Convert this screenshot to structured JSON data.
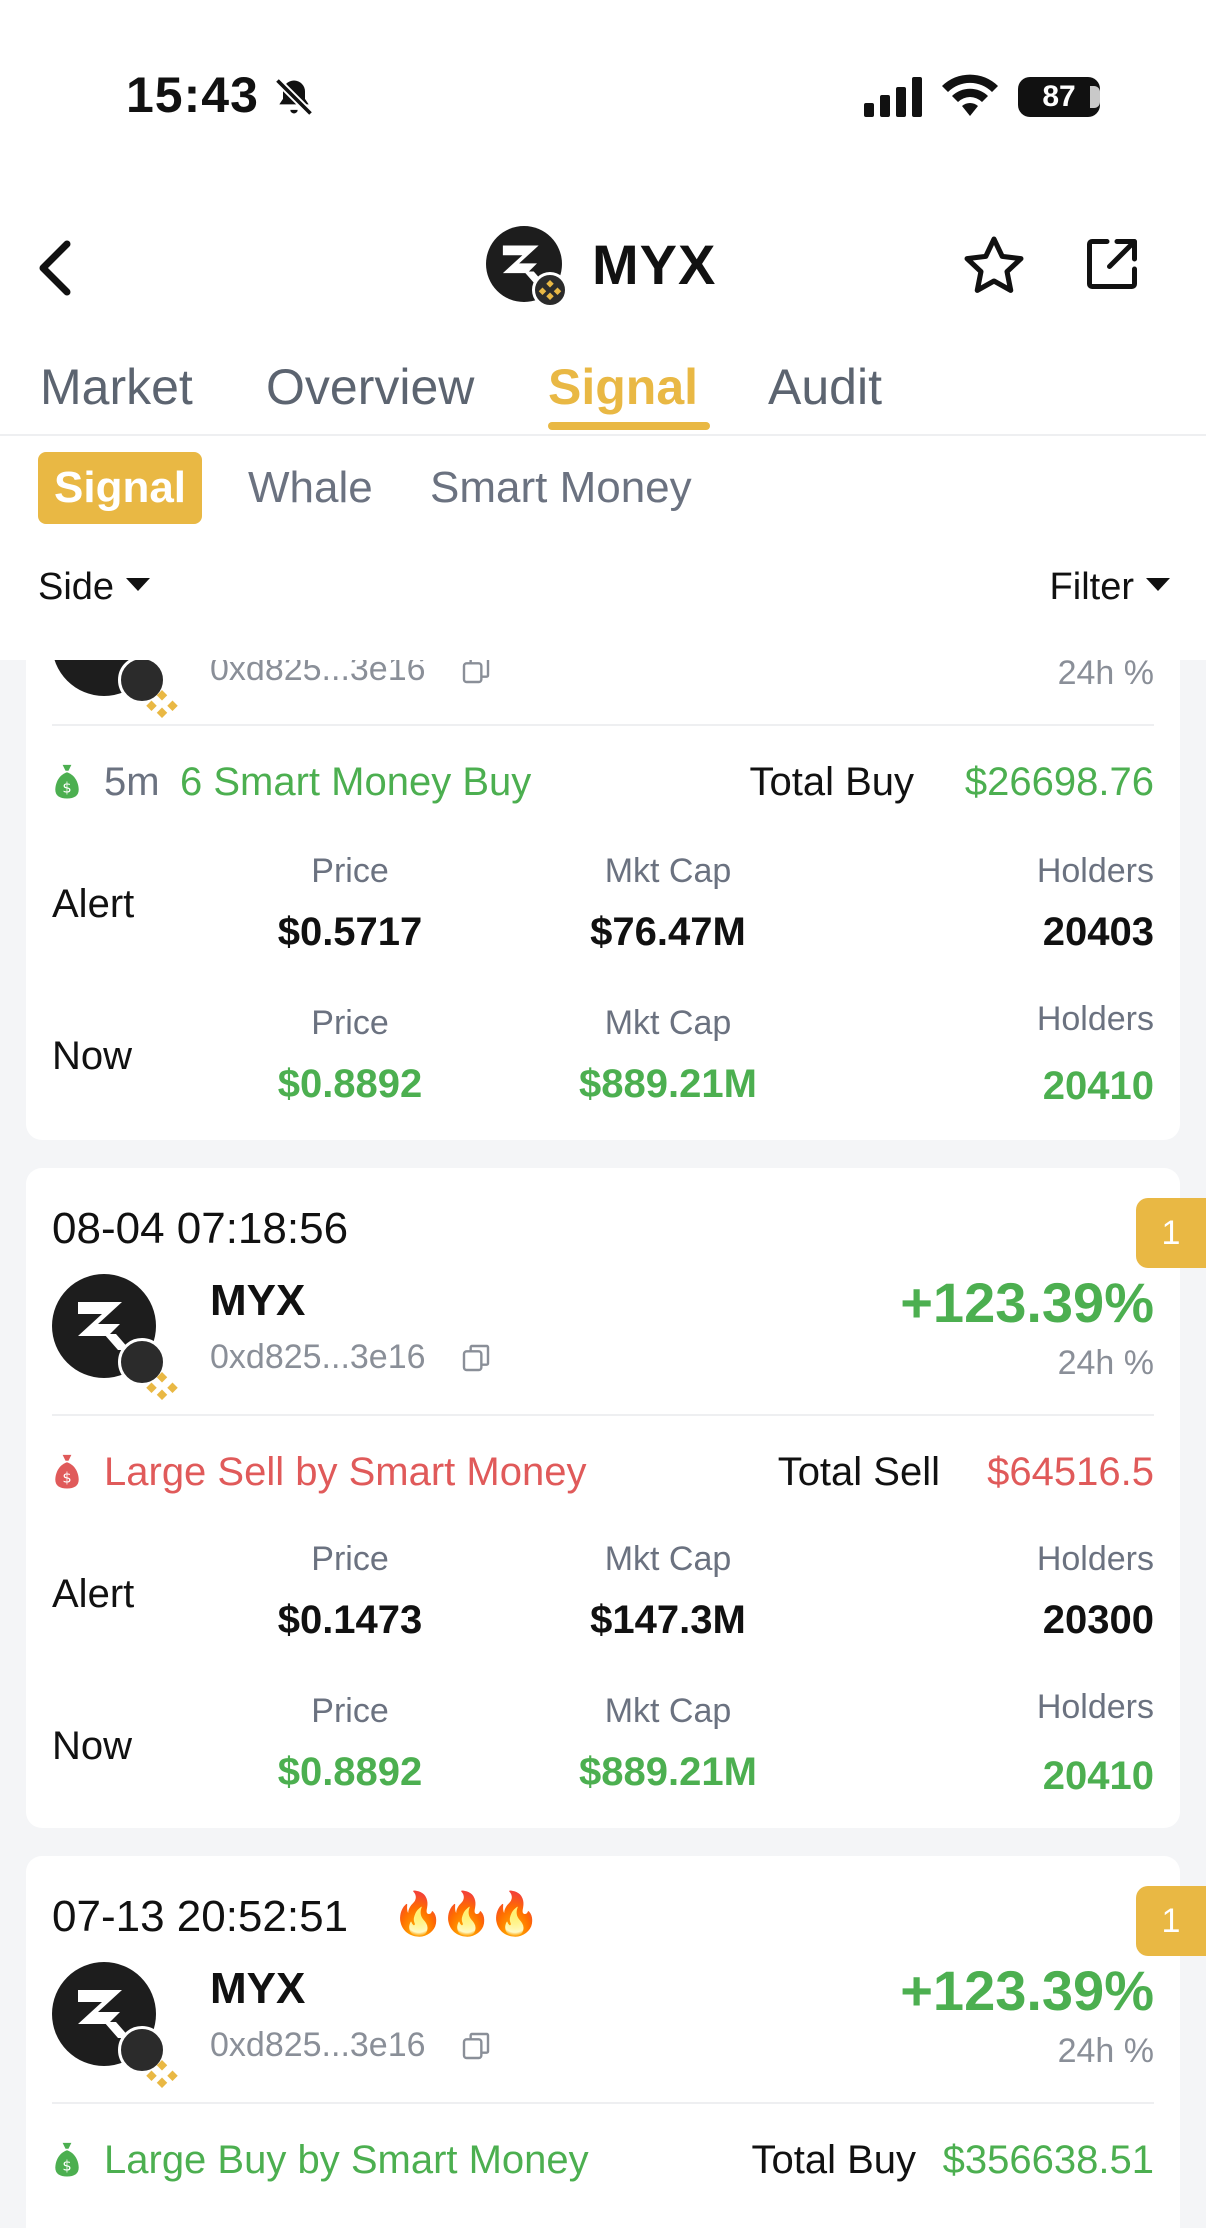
{
  "status": {
    "time": "15:43",
    "battery": "87"
  },
  "nav": {
    "title": "MYX"
  },
  "tabs": [
    {
      "label": "Market"
    },
    {
      "label": "Overview"
    },
    {
      "label": "Signal"
    },
    {
      "label": "Audit"
    }
  ],
  "chips": [
    {
      "label": "Signal"
    },
    {
      "label": "Whale"
    },
    {
      "label": "Smart Money"
    }
  ],
  "filters": {
    "side": "Side",
    "filter": "Filter"
  },
  "labels": {
    "pct_label": "24h %",
    "alert": "Alert",
    "now": "Now",
    "price": "Price",
    "mkt_cap": "Mkt Cap",
    "holders": "Holders"
  },
  "colors": {
    "accent": "#e9b844",
    "positive": "#4caf50",
    "negative": "#e05a5a"
  },
  "cards": [
    {
      "address": "0xd825...3e16",
      "event_time": "5m",
      "event": "6 Smart Money Buy",
      "total_label": "Total Buy",
      "total_value": "$26698.76",
      "alert": {
        "price": "$0.5717",
        "mkt_cap": "$76.47M",
        "holders": "20403"
      },
      "now": {
        "price": "$0.8892",
        "mkt_cap": "$889.21M",
        "holders": "20410"
      }
    },
    {
      "timestamp": "08-04 07:18:56",
      "symbol": "MYX",
      "address": "0xd825...3e16",
      "change": "+123.39%",
      "badge": "1",
      "event": "Large Sell by Smart Money",
      "total_label": "Total Sell",
      "total_value": "$64516.5",
      "alert": {
        "price": "$0.1473",
        "mkt_cap": "$147.3M",
        "holders": "20300"
      },
      "now": {
        "price": "$0.8892",
        "mkt_cap": "$889.21M",
        "holders": "20410"
      }
    },
    {
      "timestamp": "07-13 20:52:51",
      "fire": [
        "🔥",
        "🔥",
        "🔥"
      ],
      "symbol": "MYX",
      "address": "0xd825...3e16",
      "change": "+123.39%",
      "badge": "1",
      "event": "Large Buy by Smart Money",
      "total_label": "Total Buy",
      "total_value": "$356638.51"
    }
  ]
}
